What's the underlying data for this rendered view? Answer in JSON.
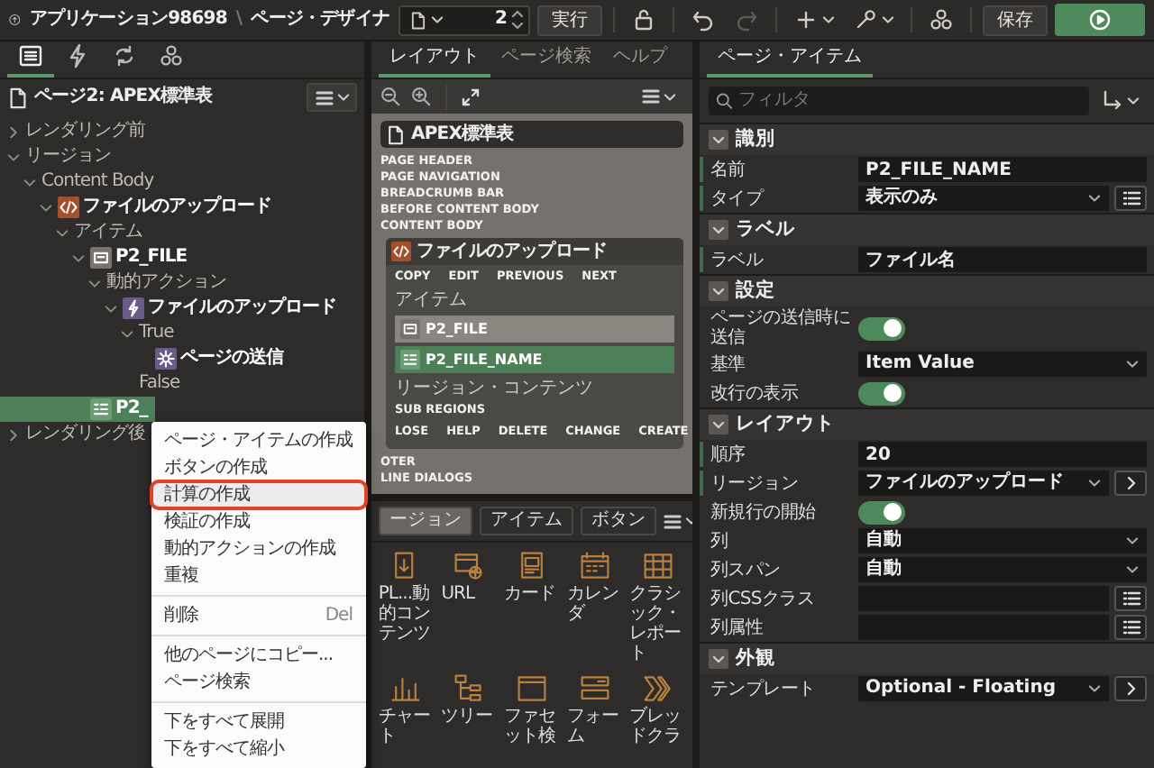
{
  "topbar": {
    "app_title": "アプリケーション98698",
    "separator": "\\",
    "page_title": "ページ・デザイナ",
    "page_number": "2",
    "run_label": "実行",
    "save_label": "保存",
    "tools": [
      {
        "kind": "lock",
        "disabled": false
      },
      {
        "kind": "undo",
        "disabled": false
      },
      {
        "kind": "redo",
        "disabled": true
      },
      {
        "kind": "add",
        "disabled": false
      },
      {
        "kind": "utilities",
        "disabled": false
      },
      {
        "kind": "shared",
        "disabled": false
      }
    ]
  },
  "left_panel": {
    "tabs": [
      {
        "kind": "rendering",
        "selected": true
      },
      {
        "kind": "dynamic_actions",
        "selected": false
      },
      {
        "kind": "processing",
        "selected": false
      },
      {
        "kind": "shared",
        "selected": false
      }
    ],
    "tree_title": "ページ2: APEX標準表",
    "tree": [
      {
        "label": "レンダリング前",
        "kind": "group",
        "expanded": false,
        "selected": false
      },
      {
        "label": "リージョン",
        "kind": "group",
        "expanded": true,
        "selected": false,
        "children": [
          {
            "label": "Content Body",
            "kind": "group",
            "expanded": true,
            "selected": false,
            "children": [
              {
                "label": "ファイルのアップロード",
                "kind": "region",
                "expanded": true,
                "selected": false,
                "children": [
                  {
                    "label": "アイテム",
                    "kind": "group",
                    "expanded": true,
                    "selected": false,
                    "children": [
                      {
                        "label": "P2_FILE",
                        "kind": "file_item",
                        "expanded": true,
                        "selected": false,
                        "children": [
                          {
                            "label": "動的アクション",
                            "kind": "group",
                            "expanded": true,
                            "selected": false,
                            "children": [
                              {
                                "label": "ファイルのアップロード",
                                "kind": "action",
                                "expanded": true,
                                "selected": false,
                                "children": [
                                  {
                                    "label": "True",
                                    "kind": "group",
                                    "expanded": true,
                                    "selected": false,
                                    "children": [
                                      {
                                        "label": "ページの送信",
                                        "kind": "step",
                                        "selected": false
                                      }
                                    ]
                                  },
                                  {
                                    "label": "False",
                                    "kind": "group",
                                    "selected": false
                                  }
                                ]
                              }
                            ]
                          }
                        ]
                      },
                      {
                        "label": "P2_",
                        "kind": "display_item",
                        "selected": true
                      }
                    ]
                  }
                ]
              }
            ]
          }
        ]
      },
      {
        "label": "レンダリング後",
        "kind": "group",
        "expanded": false,
        "selected": false
      }
    ]
  },
  "context_menu": {
    "groups": [
      [
        {
          "label": "ページ・アイテムの作成",
          "highlighted": false
        },
        {
          "label": "ボタンの作成",
          "highlighted": false
        },
        {
          "label": "計算の作成",
          "highlighted": true
        },
        {
          "label": "検証の作成",
          "highlighted": false
        },
        {
          "label": "動的アクションの作成",
          "highlighted": false
        },
        {
          "label": "重複",
          "highlighted": false
        }
      ],
      [
        {
          "label": "削除",
          "shortcut": "Del",
          "highlighted": false
        }
      ],
      [
        {
          "label": "他のページにコピー...",
          "highlighted": false
        },
        {
          "label": "ページ検索",
          "highlighted": false
        }
      ],
      [
        {
          "label": "下をすべて展開",
          "highlighted": false
        },
        {
          "label": "下をすべて縮小",
          "highlighted": false
        }
      ]
    ]
  },
  "middle_panel": {
    "tabs": [
      {
        "label": "レイアウト",
        "selected": true
      },
      {
        "label": "ページ検索",
        "selected": false
      },
      {
        "label": "ヘルプ",
        "selected": false
      }
    ],
    "layout": {
      "page_title": "APEX標準表",
      "positions_before": [
        "PAGE HEADER",
        "PAGE NAVIGATION",
        "BREADCRUMB BAR",
        "BEFORE CONTENT BODY",
        "CONTENT BODY"
      ],
      "region": {
        "title": "ファイルのアップロード",
        "top_positions": [
          "COPY",
          "EDIT",
          "PREVIOUS",
          "NEXT"
        ],
        "items_label": "アイテム",
        "items": [
          {
            "name": "P2_FILE",
            "kind": "file_item",
            "selected": false
          },
          {
            "name": "P2_FILE_NAME",
            "kind": "display_item",
            "selected": true
          }
        ],
        "content_label": "リージョン・コンテンツ",
        "sub_regions": "SUB REGIONS",
        "bottom_positions": [
          "LOSE",
          "HELP",
          "DELETE",
          "CHANGE",
          "CREATE"
        ]
      },
      "positions_after": [
        "OTER",
        "LINE DIALOGS"
      ]
    },
    "gallery_tabs": [
      {
        "label": "ージョン",
        "selected": true
      },
      {
        "label": "アイテム",
        "selected": false
      },
      {
        "label": "ボタン",
        "selected": false
      }
    ],
    "gallery": [
      {
        "label": "PL...動的コンテンツ",
        "kind": "plsql"
      },
      {
        "label": "URL",
        "kind": "url"
      },
      {
        "label": "カード",
        "kind": "card"
      },
      {
        "label": "カレンダ",
        "kind": "calendar"
      },
      {
        "label": "クラシック・レポート",
        "kind": "report"
      },
      {
        "label": "チャート",
        "kind": "chart"
      },
      {
        "label": "ツリー",
        "kind": "tree"
      },
      {
        "label": "ファセット検",
        "kind": "facet"
      },
      {
        "label": "フォーム",
        "kind": "form"
      },
      {
        "label": "ブレッドクラ",
        "kind": "breadcrumb"
      }
    ]
  },
  "right_panel": {
    "tab": "ページ・アイテム",
    "filter_placeholder": "フィルタ",
    "sections": [
      {
        "title": "識別",
        "expanded": true,
        "rows": [
          {
            "label": "名前",
            "kind": "text",
            "value": "P2_FILE_NAME",
            "required": true
          },
          {
            "label": "タイプ",
            "kind": "select",
            "value": "表示のみ",
            "button": {
              "kind": "list"
            },
            "required": true
          }
        ]
      },
      {
        "title": "ラベル",
        "expanded": true,
        "rows": [
          {
            "label": "ラベル",
            "kind": "text",
            "value": "ファイル名",
            "required": true
          }
        ]
      },
      {
        "title": "設定",
        "expanded": true,
        "rows": [
          {
            "label": "ページの送信時に送信",
            "kind": "switch",
            "on": true,
            "required": false
          },
          {
            "label": "基準",
            "kind": "select",
            "value": "Item Value",
            "required": false
          },
          {
            "label": "改行の表示",
            "kind": "switch",
            "on": true,
            "required": false
          }
        ]
      },
      {
        "title": "レイアウト",
        "expanded": true,
        "rows": [
          {
            "label": "順序",
            "kind": "text",
            "value": "20",
            "required": true
          },
          {
            "label": "リージョン",
            "kind": "select",
            "value": "ファイルのアップロード",
            "button": {
              "kind": "go"
            },
            "required": true
          },
          {
            "label": "新規行の開始",
            "kind": "switch",
            "on": true,
            "required": false
          },
          {
            "label": "列",
            "kind": "select",
            "value": "自動",
            "required": false
          },
          {
            "label": "列スパン",
            "kind": "select",
            "value": "自動",
            "required": false
          },
          {
            "label": "列CSSクラス",
            "kind": "text",
            "button": {
              "kind": "list"
            },
            "required": false
          },
          {
            "label": "列属性",
            "kind": "text",
            "button": {
              "kind": "list"
            },
            "required": false
          }
        ]
      },
      {
        "title": "外観",
        "expanded": true,
        "rows": [
          {
            "label": "テンプレート",
            "kind": "select",
            "value": "Optional - Floating",
            "button": {
              "kind": "go"
            },
            "required": false
          }
        ]
      }
    ]
  }
}
